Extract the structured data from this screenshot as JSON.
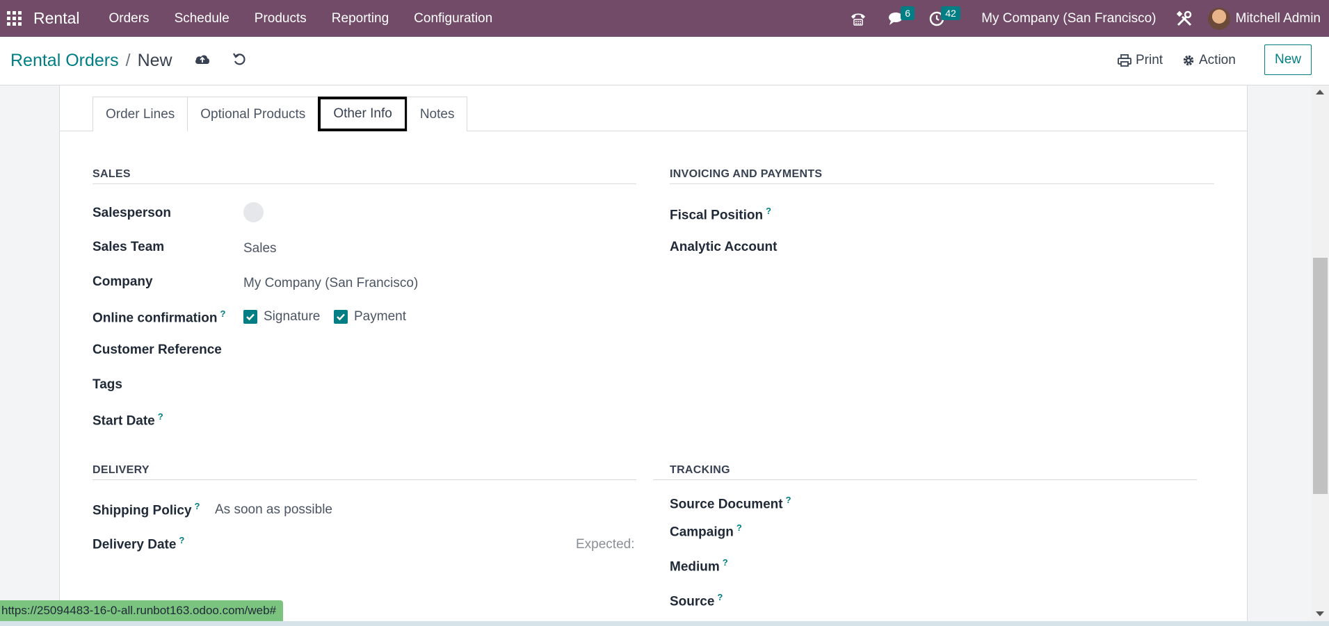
{
  "navbar": {
    "brand": "Rental",
    "menu": [
      "Orders",
      "Schedule",
      "Products",
      "Reporting",
      "Configuration"
    ],
    "messages_count": "6",
    "activities_count": "42",
    "company": "My Company (San Francisco)",
    "user": "Mitchell Admin",
    "color": "#714b67"
  },
  "control": {
    "breadcrumb_parent": "Rental Orders",
    "breadcrumb_sep": "/",
    "breadcrumb_current": "New",
    "print_label": "Print",
    "action_label": "Action",
    "new_label": "New"
  },
  "tabs": [
    "Order Lines",
    "Optional Products",
    "Other Info",
    "Notes"
  ],
  "active_tab": "Other Info",
  "sales": {
    "title": "SALES",
    "salesperson_label": "Salesperson",
    "sales_team_label": "Sales Team",
    "sales_team_value": "Sales",
    "company_label": "Company",
    "company_value": "My Company (San Francisco)",
    "online_confirmation_label": "Online confirmation",
    "signature_label": "Signature",
    "payment_label": "Payment",
    "customer_reference_label": "Customer Reference",
    "tags_label": "Tags",
    "start_date_label": "Start Date"
  },
  "invoicing": {
    "title": "INVOICING AND PAYMENTS",
    "fiscal_position_label": "Fiscal Position",
    "analytic_account_label": "Analytic Account"
  },
  "delivery": {
    "title": "DELIVERY",
    "shipping_policy_label": "Shipping Policy",
    "shipping_policy_value": "As soon as possible",
    "delivery_date_label": "Delivery Date",
    "expected_label": "Expected:"
  },
  "tracking": {
    "title": "TRACKING",
    "source_document_label": "Source Document",
    "campaign_label": "Campaign",
    "medium_label": "Medium",
    "source_label": "Source"
  },
  "help_mark": "?",
  "status_url": "https://25094483-16-0-all.runbot163.odoo.com/web#",
  "accent_color": "#017e84"
}
